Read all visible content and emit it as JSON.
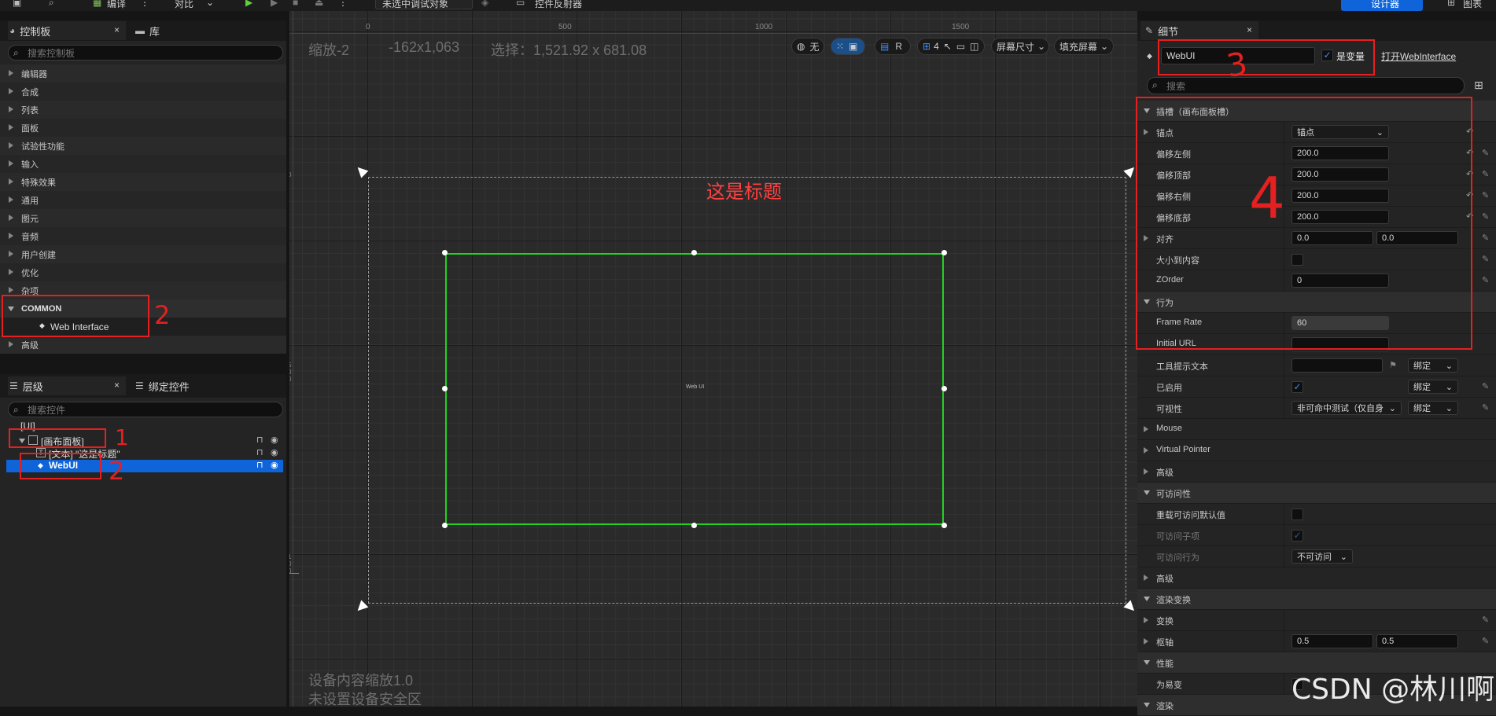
{
  "toolbar": {
    "compile": "编译",
    "diff": "对比",
    "debug_target": "未选中调试对象",
    "widget_reflector": "控件反射器",
    "designer": "设计器",
    "graph": "图表"
  },
  "palette": {
    "tab_palette": "控制板",
    "tab_library": "库",
    "search_placeholder": "搜索控制板",
    "categories": [
      "编辑器",
      "合成",
      "列表",
      "面板",
      "试验性功能",
      "输入",
      "特殊效果",
      "通用",
      "图元",
      "音频",
      "用户创建",
      "优化",
      "杂项"
    ],
    "common_label": "COMMON",
    "common_item": "Web Interface",
    "advanced": "高级"
  },
  "hierarchy": {
    "tab_hierarchy": "层级",
    "tab_bind": "绑定控件",
    "search_placeholder": "搜索控件",
    "root": "[UI]",
    "canvas": "[画布面板]",
    "text": "[文本] \"这是标题\"",
    "webui": "WebUI"
  },
  "viewport": {
    "zoom": "缩放-2",
    "coords": "-162x1,063",
    "selection": "选择：1,521.92 x 681.08",
    "ruler_500": "500",
    "ruler_1000": "1000",
    "ruler_1500": "1500",
    "ruler_0": "0",
    "left_ruler_500": "500",
    "left_ruler_1000": "100",
    "none": "无",
    "r_label": "R",
    "grid_num": "4",
    "screen_size": "屏幕尺寸",
    "fill_screen": "填充屏幕",
    "title_text": "这是标题",
    "webui_label": "Web UI",
    "dpi_scale": "设备内容缩放1.0",
    "safe_zone": "未设置设备安全区"
  },
  "details": {
    "tab": "细节",
    "name_value": "WebUI",
    "is_variable": "是变量",
    "open_link": "打开WebInterface",
    "search_placeholder": "搜索",
    "slot_section": "插槽（画布面板槽）",
    "anchors": "锚点",
    "anchors_value": "锚点",
    "offset_left": "偏移左侧",
    "offset_top": "偏移顶部",
    "offset_right": "偏移右侧",
    "offset_bottom": "偏移底部",
    "offset_value": "200.0",
    "alignment": "对齐",
    "align_x": "0.0",
    "align_y": "0.0",
    "size_to_content": "大小到内容",
    "zorder": "ZOrder",
    "zorder_value": "0",
    "behavior": "行为",
    "frame_rate": "Frame Rate",
    "frame_rate_value": "60",
    "initial_url": "Initial URL",
    "tooltip_text": "工具提示文本",
    "bind": "绑定",
    "is_enabled": "已启用",
    "visibility": "可视性",
    "visibility_value": "非可命中测试（仅自身",
    "mouse": "Mouse",
    "virtual_pointer": "Virtual Pointer",
    "advanced": "高级",
    "accessibility": "可访问性",
    "override_access": "重载可访问默认值",
    "access_children": "可访问子项",
    "access_behavior": "可访问行为",
    "not_accessible": "不可访问",
    "advanced2": "高级",
    "render_transform": "渲染变换",
    "transform": "变换",
    "pivot": "枢轴",
    "pivot_x": "0.5",
    "pivot_y": "0.5",
    "performance": "性能",
    "is_volatile": "为易变",
    "rendering": "渲染"
  },
  "annotations": {
    "n1": "1",
    "n2a": "2",
    "n2b": "2",
    "n3": "3",
    "n4": "4"
  },
  "watermark": "CSDN @林川啊",
  "colors": {
    "accent_blue": "#0e64d8",
    "annotation_red": "#e52020",
    "selection_green": "#22d022"
  }
}
